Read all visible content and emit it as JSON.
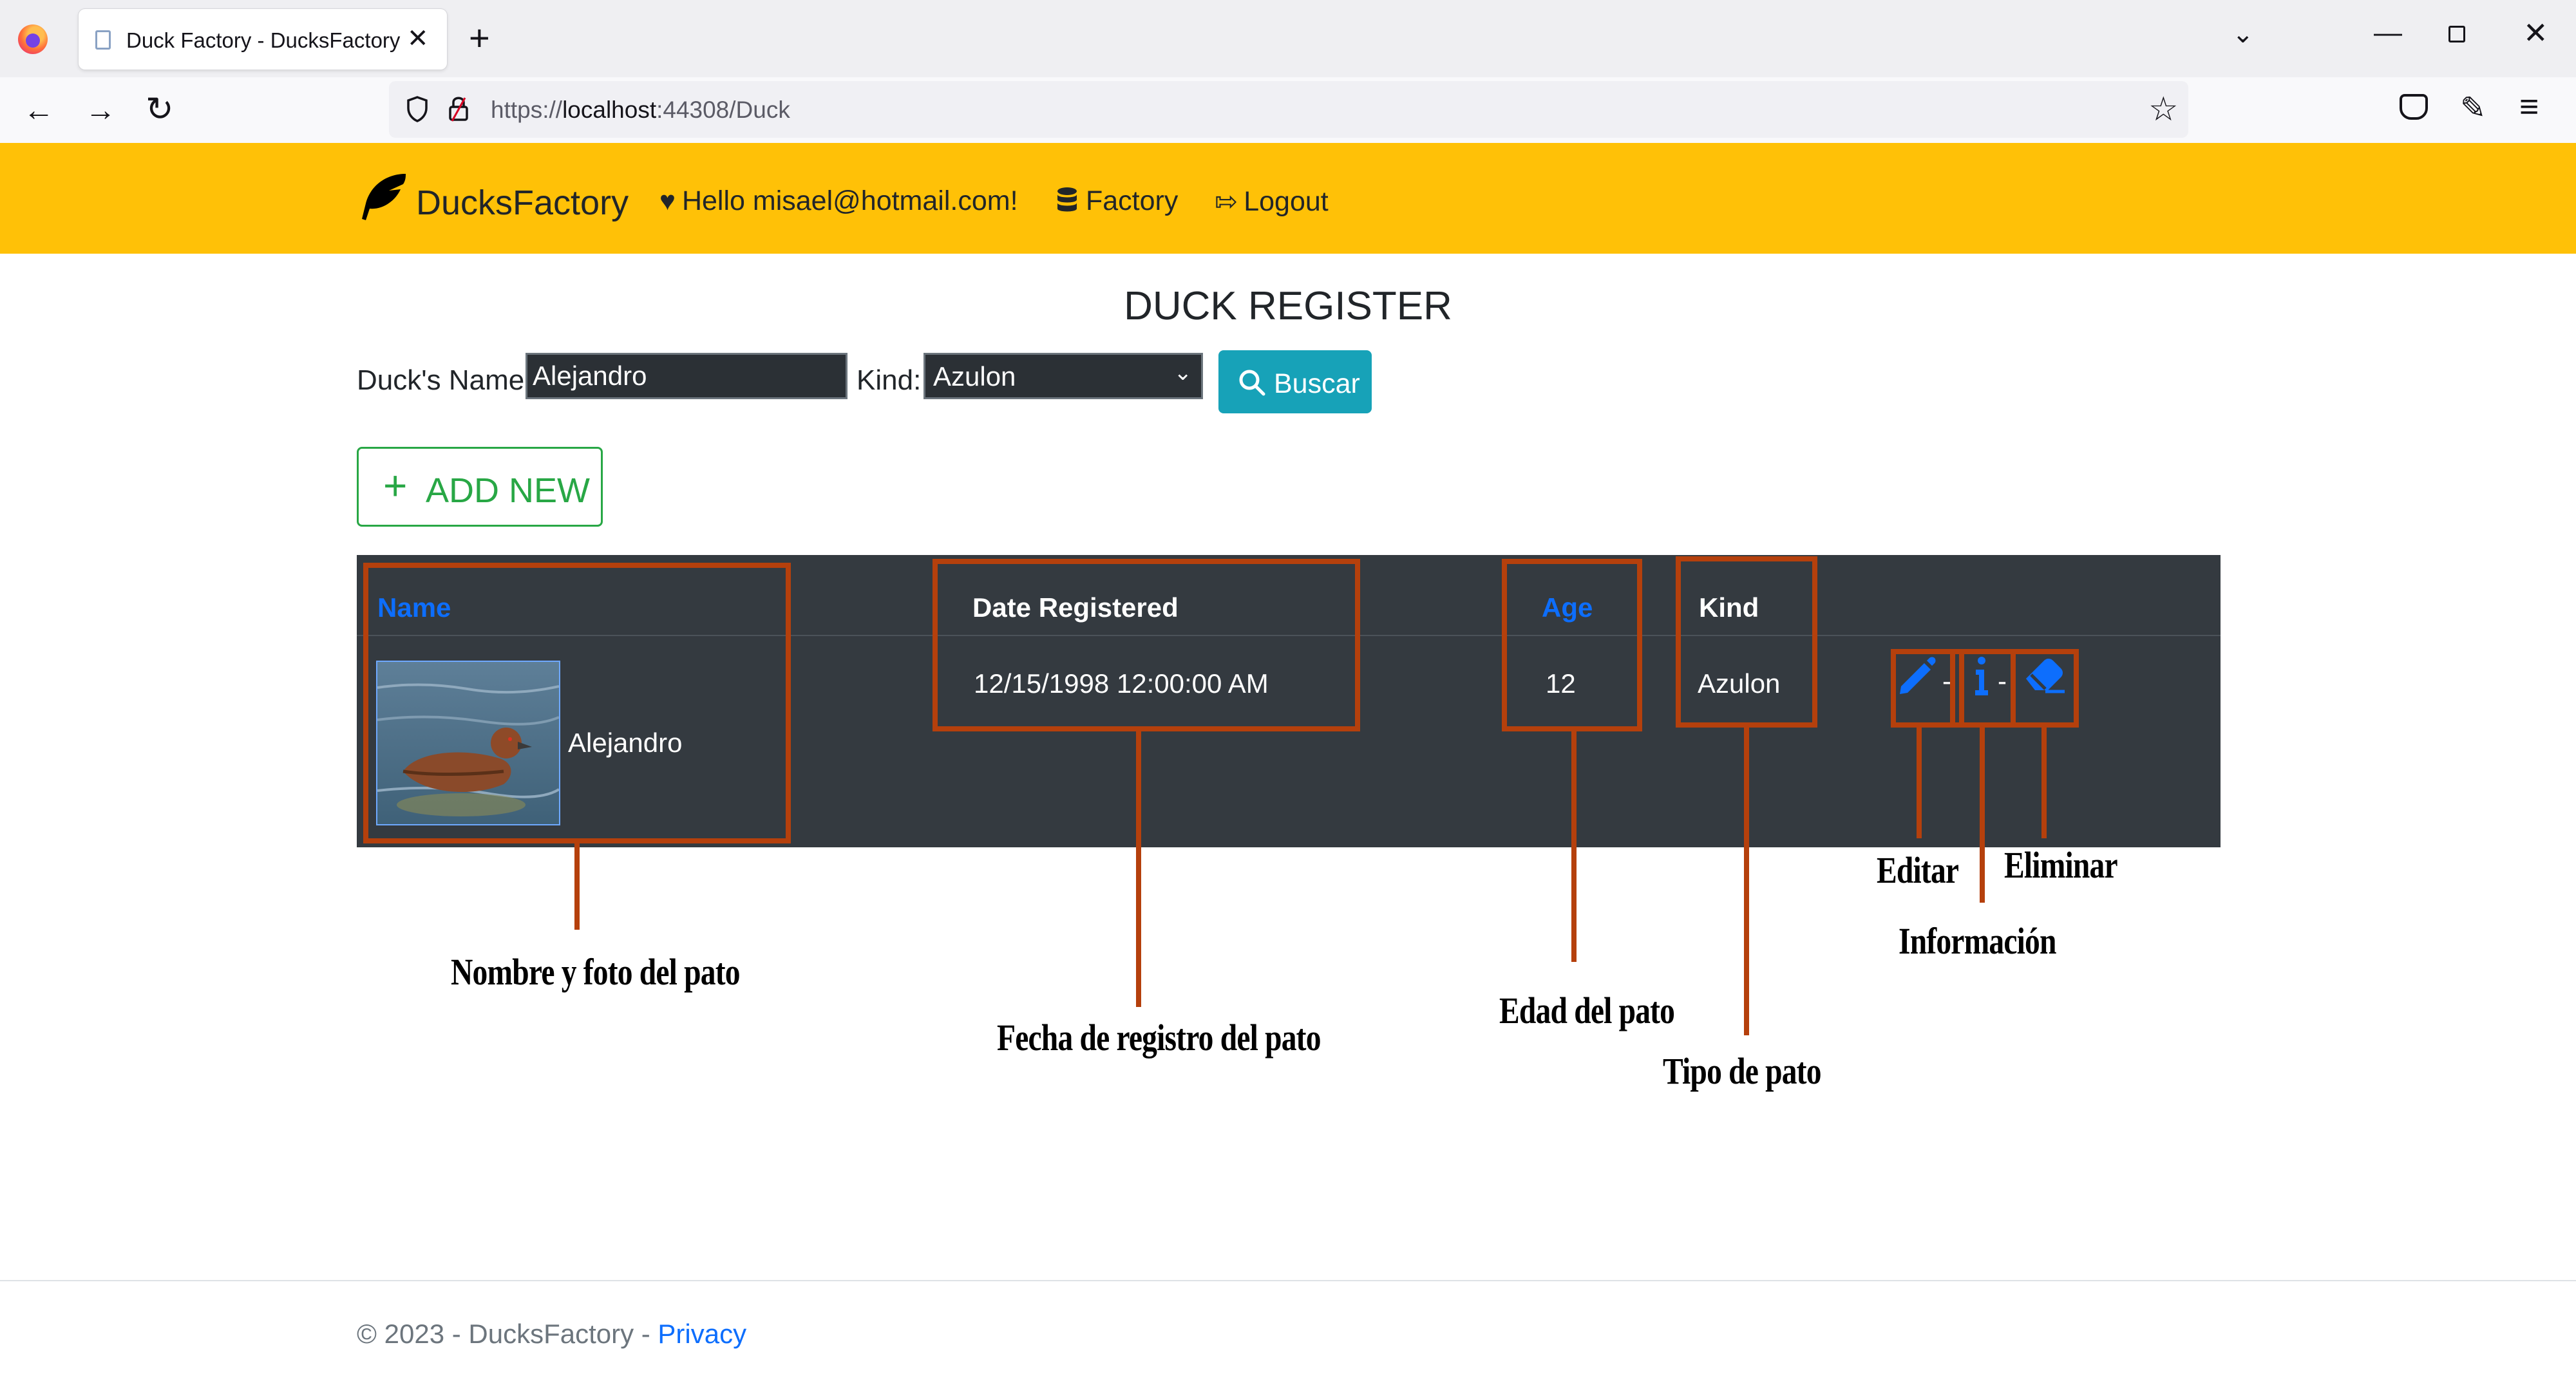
{
  "browser": {
    "tab_title": "Duck Factory - DucksFactory",
    "tab_close": "✕",
    "new_tab": "+",
    "url_prefix": "https://",
    "url_host": "localhost",
    "url_rest": ":44308/Duck"
  },
  "nav": {
    "brand": "DucksFactory",
    "hello": "Hello misael@hotmail.com!",
    "factory": "Factory",
    "logout": "Logout"
  },
  "main": {
    "title": "DUCK REGISTER",
    "name_label": "Duck's Name:",
    "name_value": "Alejandro",
    "kind_label": "Kind:",
    "kind_value": "Azulon",
    "search_button": "Buscar",
    "add_button": "ADD NEW"
  },
  "table": {
    "headers": [
      "Name",
      "Date Registered",
      "Age",
      "Kind"
    ],
    "rows": [
      {
        "name": "Alejandro",
        "date": "12/15/1998 12:00:00 AM",
        "age": "12",
        "kind": "Azulon"
      }
    ],
    "separator": "-"
  },
  "annotations": {
    "name_photo": "Nombre y foto del pato",
    "date": "Fecha de registro del pato",
    "age": "Edad del pato",
    "kind": "Tipo de pato",
    "edit": "Editar",
    "info": "Información",
    "delete": "Eliminar"
  },
  "footer": {
    "copyright": "© 2023 - DucksFactory - ",
    "privacy": "Privacy"
  },
  "colors": {
    "navbar": "#ffc107",
    "table_bg": "#343a40",
    "link": "#0d6efd",
    "success": "#28a745",
    "info": "#17a2b8",
    "annotation": "#b5400c"
  },
  "icons": [
    "firefox-logo-icon",
    "page-icon",
    "close-icon",
    "plus-icon",
    "chevron-down-icon",
    "minimize-icon",
    "restore-icon",
    "back-icon",
    "forward-icon",
    "reload-icon",
    "shield-icon",
    "lock-icon",
    "star-icon",
    "pocket-icon",
    "extensions-icon",
    "menu-icon",
    "feather-icon",
    "heart-icon",
    "database-icon",
    "logout-icon",
    "search-icon",
    "pencil-icon",
    "info-icon",
    "eraser-icon"
  ]
}
